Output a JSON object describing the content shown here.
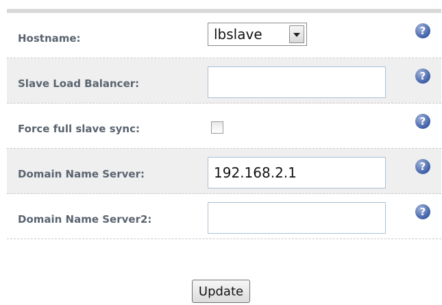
{
  "form": {
    "rows": [
      {
        "label": "Hostname:",
        "control": "select",
        "value": "lbslave",
        "help_icon": "help-question-icon"
      },
      {
        "label": "Slave Load Balancer:",
        "control": "text",
        "value": "",
        "help_icon": "help-question-icon"
      },
      {
        "label": "Force full slave sync:",
        "control": "checkbox",
        "checked": false,
        "help_icon": "help-question-icon"
      },
      {
        "label": "Domain Name Server:",
        "control": "text",
        "value": "192.168.2.1",
        "help_icon": "help-question-icon"
      },
      {
        "label": "Domain Name Server2:",
        "control": "text",
        "value": "",
        "help_icon": "help-question-icon"
      }
    ],
    "help_glyph": "?"
  },
  "actions": {
    "update_label": "Update"
  }
}
